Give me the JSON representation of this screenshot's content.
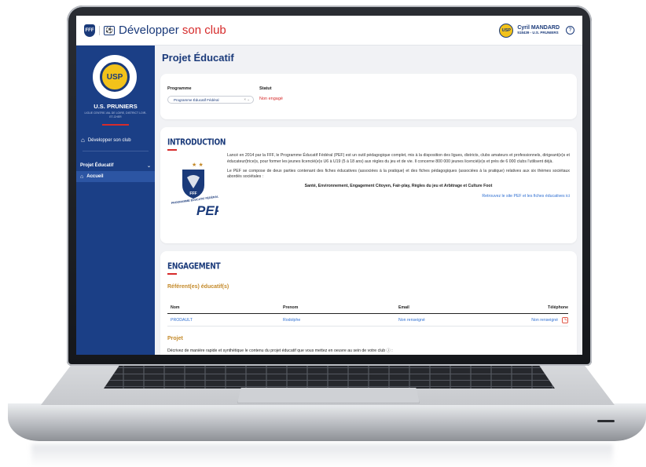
{
  "header": {
    "app_title_main": "Développer",
    "app_title_accent": "son club",
    "user_logo": "USP",
    "user_name": "Cyril MANDARD",
    "user_sub": "518439 - U.S. PRUNIERS",
    "fff_logo": "FFF",
    "club_icon": "⚽",
    "help_icon": "?"
  },
  "sidebar": {
    "badge": "USP",
    "club_name": "U.S. PRUNIERS",
    "club_league": "LIGUE CENTRE-VAL DE LOIRE, DISTRICT LOIR-ET-CHER",
    "link_develop": "Développer son club",
    "section": "Projet Éducatif",
    "section_chevron": "⌄",
    "active_item": "Accueil",
    "home_icon": "⌂"
  },
  "main": {
    "page_title": "Projet Éducatif",
    "programme_label": "Programme",
    "programme_value": "Programme Éducatif Fédéral",
    "programme_arrows": "× ⌄",
    "statut_label": "Statut",
    "statut_value": "Non engagé",
    "intro_title": "INTRODUCTION",
    "intro_p1": "Lancé en 2014 par la FFF, le Programme Éducatif Fédéral (PEF) est un outil pédagogique complet, mis à la disposition des ligues, districts, clubs amateurs et professionnels, dirigeant(e)s et éducateur(trice)s, pour former les jeunes licencié(e)s U6 à U19 (5 à 18 ans) aux règles du jeu et de vie. Il concerne 800 000 jeunes licencié(e)s et près de 6 000 clubs l'utilisent déjà.",
    "intro_p2": "Le PEF se compose de deux parties contenant des fiches éducatives (associées à la pratique) et des fiches pédagogiques (associées à la pratique) relatives aux six thèmes sociétaux abordés sociétales :",
    "intro_themes": "Santé, Environnement, Engagement Citoyen, Fair-play, Règles du jeu et Arbitrage et Culture Foot",
    "intro_link": "Retrouvez le site PEF et les fiches éducatives ici",
    "pef_logo_fff": "FFF",
    "pef_logo_text": "PEF",
    "pef_logo_side": "PROGRAMME ÉDUCATIF FÉDÉRAL",
    "engagement_title": "ENGAGEMENT",
    "referents_title": "Référent(es) éducatif(s)",
    "table_headers": [
      "Nom",
      "Prenom",
      "Email",
      "Téléphone"
    ],
    "table_row": [
      "PRODAULT",
      "Rodolphe",
      "Non renseigné",
      "Non renseigné"
    ],
    "edit_icon": "✎",
    "projet_title": "Projet",
    "projet_desc": "Décrivez de manière rapide et synthétique le contenu du projet éducatif que vous mettez en oeuvre au sein de votre club ⓘ :"
  },
  "colors": {
    "brand_blue": "#1a3a7a",
    "accent_red": "#d62b2b",
    "sidebar_blue": "#1b3f86",
    "link_blue": "#2f6fd1",
    "gold": "#c48a2a"
  }
}
